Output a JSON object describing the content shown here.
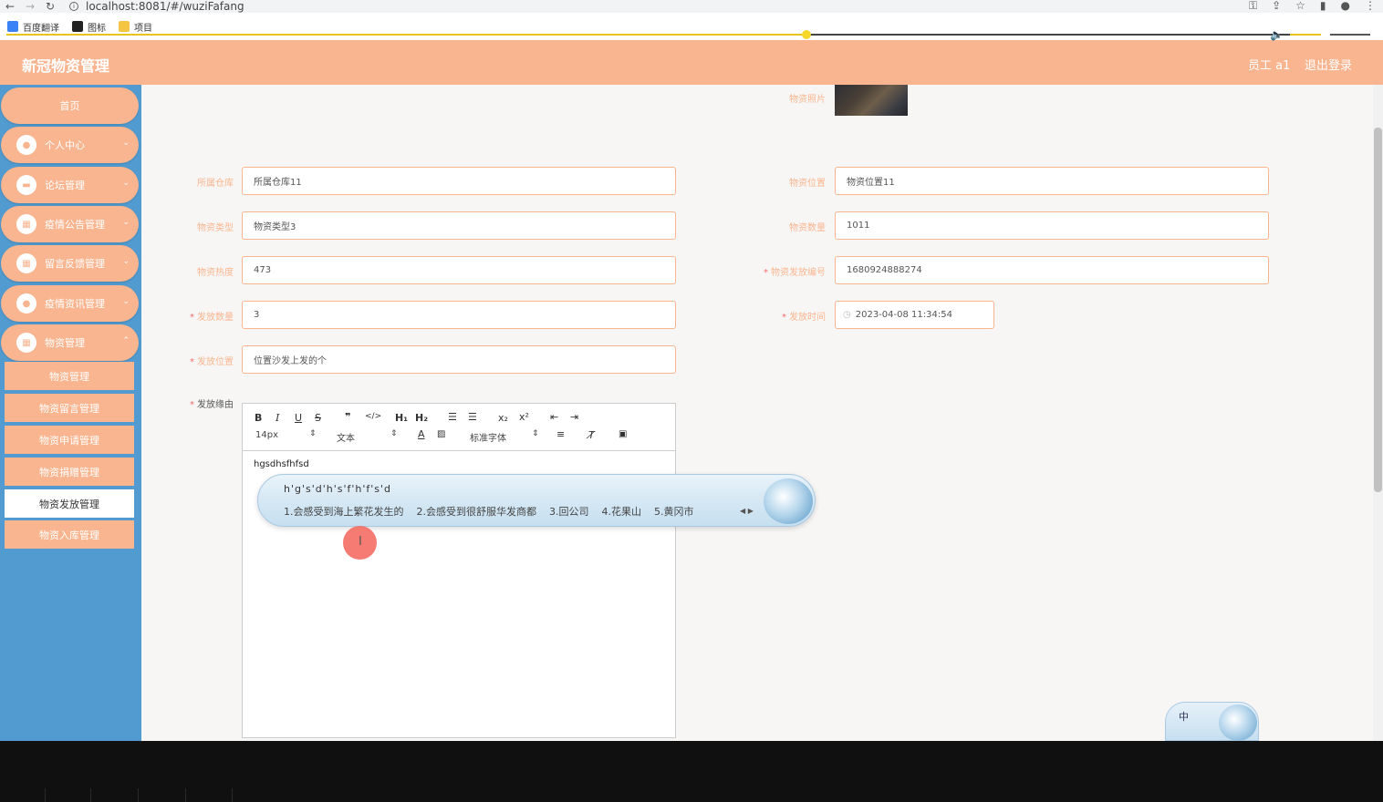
{
  "browser": {
    "url": "localhost:8081/#/wuziFafang",
    "bookmarks": [
      "百度翻译",
      "图标",
      "项目"
    ]
  },
  "header": {
    "title": "新冠物资管理",
    "user": "员工 a1",
    "logout": "退出登录"
  },
  "sidebar": {
    "home": "首页",
    "items": [
      "个人中心",
      "论坛管理",
      "疫情公告管理",
      "留言反馈管理",
      "疫情资讯管理",
      "物资管理"
    ],
    "subitems": [
      "物资管理",
      "物资留言管理",
      "物资申请管理",
      "物资捐赠管理",
      "物资发放管理",
      "物资入库管理"
    ],
    "active_subitem": "物资发放管理"
  },
  "form": {
    "photo_label": "物资照片",
    "warehouse_label": "所属仓库",
    "warehouse_value": "所属仓库11",
    "location_label": "物资位置",
    "location_value": "物资位置11",
    "type_label": "物资类型",
    "type_value": "物资类型3",
    "quantity_label": "物资数量",
    "quantity_value": "1011",
    "heat_label": "物资热度",
    "heat_value": "473",
    "code_label": "物资发放编号",
    "code_value": "1680924888274",
    "issue_qty_label": "发放数量",
    "issue_qty_value": "3",
    "issue_time_label": "发放时间",
    "issue_time_value": "2023-04-08 11:34:54",
    "issue_place_label": "发放位置",
    "issue_place_value": "位置沙发上发的个",
    "reason_label": "发放缘由"
  },
  "editor": {
    "font_size": "14px",
    "text_style": "文本",
    "font_family": "标准字体",
    "content": "hgsdhsfhfsd"
  },
  "ime": {
    "pinyin": "h'g's'd'h's'f'h'f's'd",
    "candidates": [
      "1.会感受到海上繁花发生的",
      "2.会感受到很舒服华发商都",
      "3.回公司",
      "4.花果山",
      "5.黄冈市"
    ],
    "widget_label": "中"
  },
  "player": {
    "progress": 0.587,
    "volume": 0.44
  },
  "colors": {
    "accent": "#f9b58f",
    "sidebar": "#519bd0",
    "required": "#f56c6c"
  }
}
